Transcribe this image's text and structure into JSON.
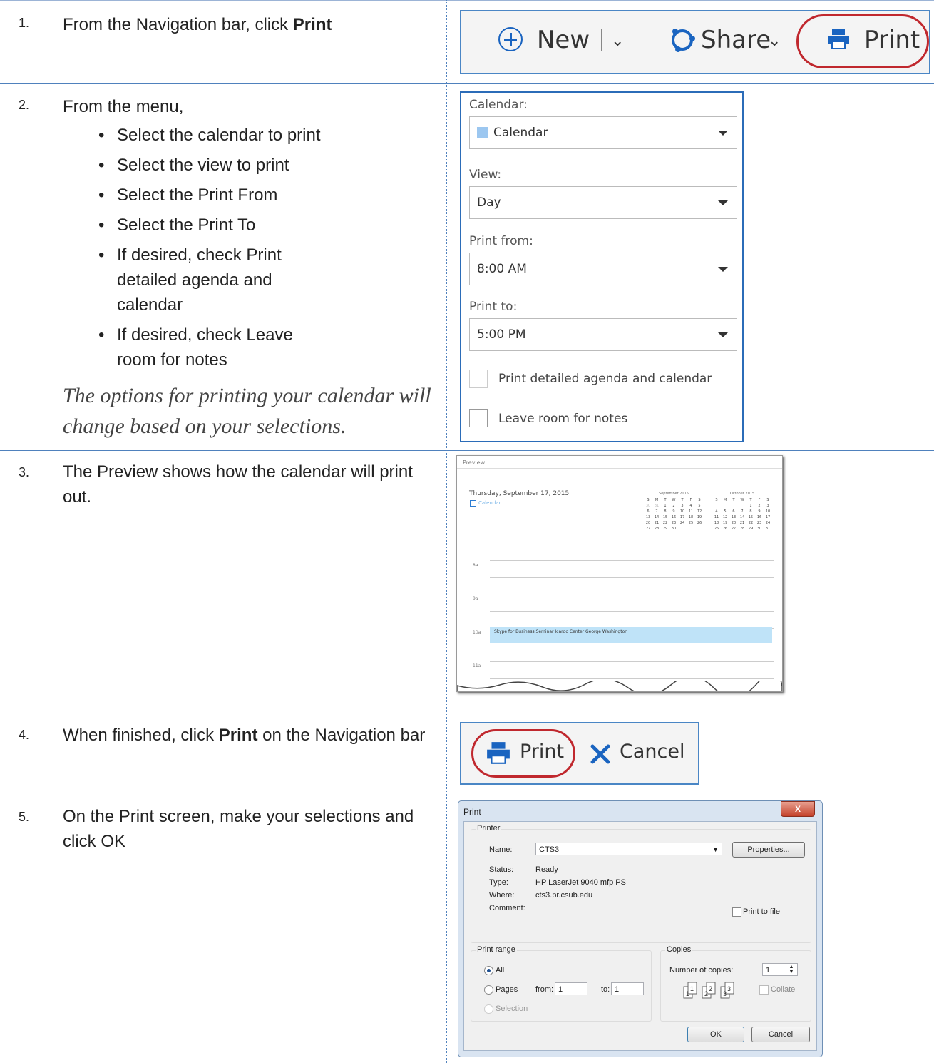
{
  "steps": [
    {
      "num": "1.",
      "text_pre": "From the Navigation bar, click ",
      "text_bold": "Print",
      "text_post": ""
    },
    {
      "num": "2.",
      "intro": "From the menu,",
      "bullets": [
        "Select the calendar to print",
        "Select the view to print",
        "Select the Print From",
        "Select the Print To",
        "If desired, check Print detailed agenda and calendar",
        "If desired, check Leave room for notes"
      ],
      "note": "The options for printing your calendar will change based on your selections."
    },
    {
      "num": "3.",
      "text": "The Preview shows how the calendar will print out."
    },
    {
      "num": "4.",
      "text_pre": "When finished, click ",
      "text_bold": "Print",
      "text_post": " on the Navigation bar"
    },
    {
      "num": "5.",
      "text": "On the Print screen, make your selections and click OK"
    }
  ],
  "nav1": {
    "new_label": "New",
    "share_label": "Share",
    "print_label": "Print"
  },
  "print_panel": {
    "calendar_label": "Calendar:",
    "calendar_value": "Calendar",
    "view_label": "View:",
    "view_value": "Day",
    "from_label": "Print from:",
    "from_value": "8:00 AM",
    "to_label": "Print to:",
    "to_value": "5:00 PM",
    "detailed_label": "Print detailed agenda and calendar",
    "notes_label": "Leave room for notes"
  },
  "preview": {
    "title": "Preview",
    "date": "Thursday, September 17, 2015",
    "calendar_name": "Calendar",
    "month1": "September 2015",
    "month2": "October 2015",
    "dow": [
      "S",
      "M",
      "T",
      "W",
      "T",
      "F",
      "S"
    ],
    "sep": [
      [
        "30",
        "31",
        "1",
        "2",
        "3",
        "4",
        "5"
      ],
      [
        "6",
        "7",
        "8",
        "9",
        "10",
        "11",
        "12"
      ],
      [
        "13",
        "14",
        "15",
        "16",
        "17",
        "18",
        "19"
      ],
      [
        "20",
        "21",
        "22",
        "23",
        "24",
        "25",
        "26"
      ],
      [
        "27",
        "28",
        "29",
        "30",
        "",
        "",
        ""
      ]
    ],
    "oct": [
      [
        "",
        "",
        "",
        "",
        "1",
        "2",
        "3"
      ],
      [
        "4",
        "5",
        "6",
        "7",
        "8",
        "9",
        "10"
      ],
      [
        "11",
        "12",
        "13",
        "14",
        "15",
        "16",
        "17"
      ],
      [
        "18",
        "19",
        "20",
        "21",
        "22",
        "23",
        "24"
      ],
      [
        "25",
        "26",
        "27",
        "28",
        "29",
        "30",
        "31"
      ]
    ],
    "hours": [
      "8a",
      "9a",
      "10a",
      "11a"
    ],
    "event": "Skype for Business Seminar Icardo Center George Washington"
  },
  "nav4": {
    "print_label": "Print",
    "cancel_label": "Cancel"
  },
  "dialog": {
    "title": "Print",
    "close": "X",
    "printer_group": "Printer",
    "name_label": "Name:",
    "name_value": "CTS3",
    "properties": "Properties...",
    "status_label": "Status:",
    "status_value": "Ready",
    "type_label": "Type:",
    "type_value": "HP LaserJet 9040 mfp PS",
    "where_label": "Where:",
    "where_value": "cts3.pr.csub.edu",
    "comment_label": "Comment:",
    "print_to_file": "Print to file",
    "range_group": "Print range",
    "all": "All",
    "pages": "Pages",
    "from": "from:",
    "from_value": "1",
    "to": "to:",
    "to_value": "1",
    "selection": "Selection",
    "copies_group": "Copies",
    "number_of_copies": "Number of copies:",
    "copies_value": "1",
    "collate": "Collate",
    "ok": "OK",
    "cancel": "Cancel"
  }
}
